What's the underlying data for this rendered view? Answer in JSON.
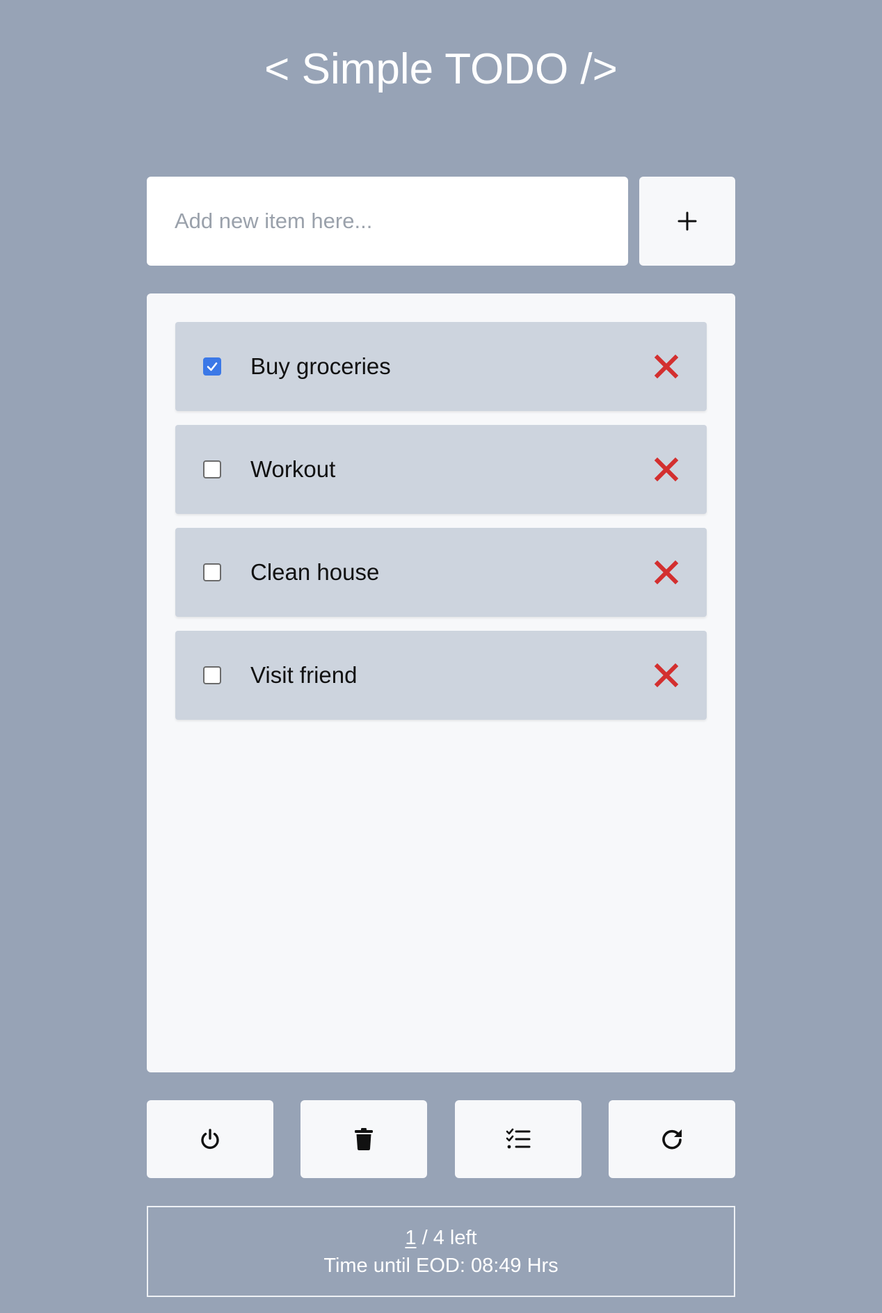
{
  "header": {
    "title": "< Simple TODO />"
  },
  "add_form": {
    "placeholder": "Add new item here...",
    "value": "",
    "add_icon": "plus-icon"
  },
  "todos": [
    {
      "label": "Buy groceries",
      "checked": true
    },
    {
      "label": "Workout",
      "checked": false
    },
    {
      "label": "Clean house",
      "checked": false
    },
    {
      "label": "Visit friend",
      "checked": false
    }
  ],
  "toolbar": {
    "buttons": [
      {
        "icon": "power-icon"
      },
      {
        "icon": "trash-icon"
      },
      {
        "icon": "checklist-icon"
      },
      {
        "icon": "refresh-icon"
      }
    ]
  },
  "status": {
    "done_count": "1",
    "total_text": " / 4 left",
    "eod_text": "Time until EOD: 08:49 Hrs"
  },
  "colors": {
    "background": "#97a3b6",
    "panel": "#f7f8fa",
    "item": "#cdd4de",
    "delete": "#d32f2f",
    "checkbox_checked": "#3b78e7"
  }
}
